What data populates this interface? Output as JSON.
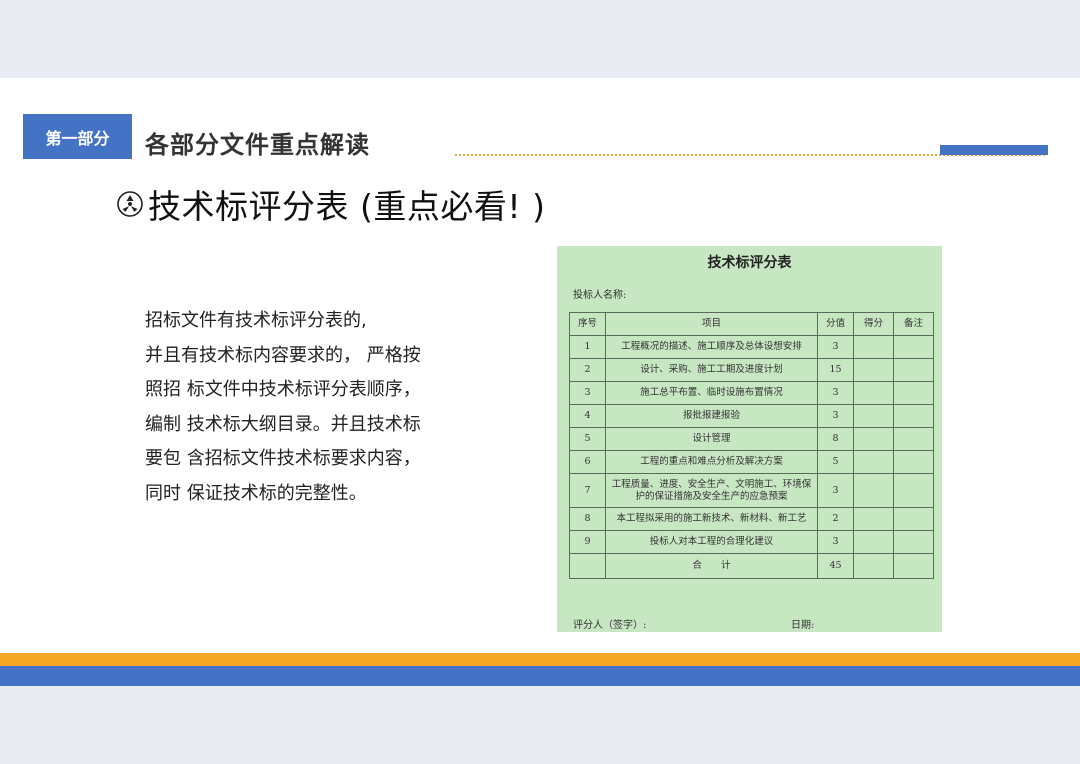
{
  "header": {
    "section_label": "第一部分",
    "section_title": "各部分文件重点解读",
    "accent_color": "#4472c4",
    "rule_color": "#e0b03c"
  },
  "heading": {
    "icon": "radiation-circle-icon",
    "text": "技术标评分表 (重点必看! )"
  },
  "body": {
    "paragraph": "    招标文件有技术标评分表的,\n并且有技术标内容要求的， 严格按\n照招 标文件中技术标评分表顺序，\n编制 技术标大纲目录。并且技术标\n要包 含招标文件技术标要求内容，\n同时 保证技术标的完整性。"
  },
  "form": {
    "background": "#c7e6c2",
    "title": "技术标评分表",
    "bidder_label": "投标人名称:",
    "columns": [
      "序号",
      "项目",
      "分值",
      "得分",
      "备注"
    ],
    "rows": [
      {
        "no": "1",
        "item": "工程概况的描述、施工顺序及总体设想安排",
        "score": "3"
      },
      {
        "no": "2",
        "item": "设计、采购、施工工期及进度计划",
        "score": "15"
      },
      {
        "no": "3",
        "item": "施工总平布置、临时设施布置情况",
        "score": "3"
      },
      {
        "no": "4",
        "item": "报批报建报验",
        "score": "3"
      },
      {
        "no": "5",
        "item": "设计管理",
        "score": "8"
      },
      {
        "no": "6",
        "item": "工程的重点和难点分析及解决方案",
        "score": "5"
      },
      {
        "no": "7",
        "item": "工程质量、进度、安全生产、文明施工、环境保护的保证措施及安全生产的应急预案",
        "score": "3"
      },
      {
        "no": "8",
        "item": "本工程拟采用的施工新技术、新材料、新工艺",
        "score": "2"
      },
      {
        "no": "9",
        "item": "投标人对本工程的合理化建议",
        "score": "3"
      }
    ],
    "total_label": "合　　计",
    "total_score": "45",
    "signer_label": "评分人（签字）:",
    "date_label": "日期:"
  },
  "footer": {
    "band_top_color": "#f5a623",
    "band_bottom_color": "#4472c4"
  }
}
